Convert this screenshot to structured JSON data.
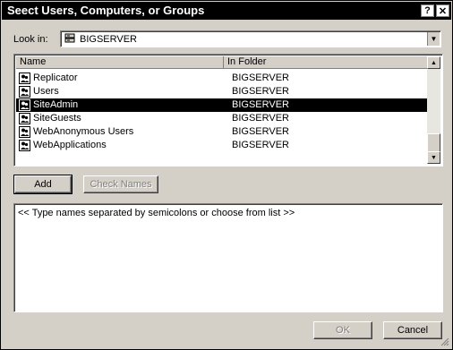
{
  "window": {
    "title": "Seect Users, Computers, or Groups",
    "help_btn": "?",
    "close_btn": "✕"
  },
  "lookin": {
    "label": "Look in:",
    "value": "BIGSERVER",
    "icon": "server-icon"
  },
  "list": {
    "columns": [
      "Name",
      "In Folder"
    ],
    "rows": [
      {
        "name": "Replicator",
        "folder": "BIGSERVER",
        "icon": "group-icon",
        "selected": false
      },
      {
        "name": "Users",
        "folder": "BIGSERVER",
        "icon": "group-icon",
        "selected": false
      },
      {
        "name": "SiteAdmin",
        "folder": "BIGSERVER",
        "icon": "group-icon",
        "selected": true
      },
      {
        "name": "SiteGuests",
        "folder": "BIGSERVER",
        "icon": "group-icon",
        "selected": false
      },
      {
        "name": "WebAnonymous Users",
        "folder": "BIGSERVER",
        "icon": "group-icon",
        "selected": false
      },
      {
        "name": "WebApplications",
        "folder": "BIGSERVER",
        "icon": "group-icon",
        "selected": false
      }
    ]
  },
  "buttons": {
    "add": "Add",
    "check_names": "Check Names",
    "ok": "OK",
    "cancel": "Cancel"
  },
  "names": {
    "placeholder": "<< Type names separated by semicolons or choose from list >>"
  },
  "colors": {
    "selection": "#000000",
    "face": "#d4d0c8"
  }
}
